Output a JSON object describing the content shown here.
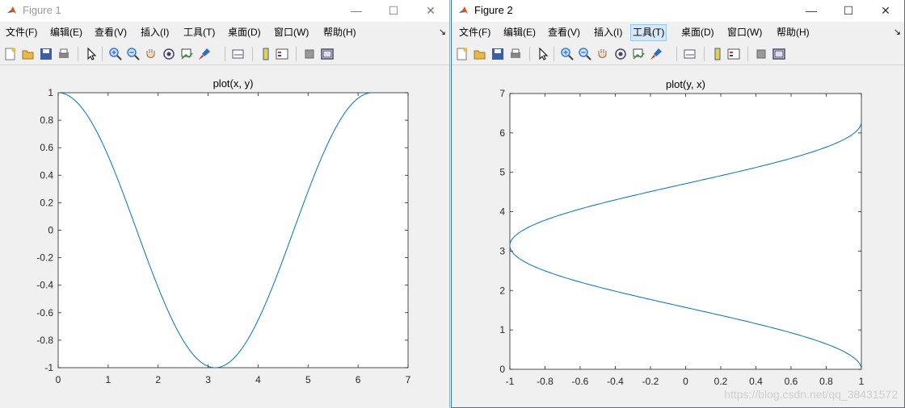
{
  "windows": [
    {
      "title": "Figure 1",
      "active": false,
      "menu": [
        "文件(F)",
        "编辑(E)",
        "查看(V)",
        "插入(I)",
        "工具(T)",
        "桌面(D)",
        "窗口(W)",
        "帮助(H)"
      ],
      "highlighted_menu": null
    },
    {
      "title": "Figure 2",
      "active": true,
      "menu": [
        "文件(F)",
        "编辑(E)",
        "查看(V)",
        "插入(I)",
        "工具(T)",
        "桌面(D)",
        "窗口(W)",
        "帮助(H)"
      ],
      "highlighted_menu": "工具(T)"
    }
  ],
  "window_controls": {
    "minimize": "—",
    "maximize": "☐",
    "close": "✕"
  },
  "menu_overflow": "↘",
  "toolbar_icons": [
    "new-figure-icon",
    "open-icon",
    "save-icon",
    "print-icon",
    "pointer-icon",
    "zoom-in-icon",
    "zoom-out-icon",
    "pan-icon",
    "rotate-3d-icon",
    "data-cursor-icon",
    "brush-icon",
    "link-plot-icon",
    "colorbar-icon",
    "legend-icon",
    "hide-plot-tools-icon",
    "show-plot-tools-icon"
  ],
  "chart_data": [
    {
      "type": "line",
      "title": "plot(x, y)",
      "xlabel": "",
      "ylabel": "",
      "xlim": [
        0,
        7
      ],
      "ylim": [
        -1,
        1
      ],
      "xticks": [
        "0",
        "1",
        "2",
        "3",
        "4",
        "5",
        "6",
        "7"
      ],
      "yticks": [
        "-1",
        "-0.8",
        "-0.6",
        "-0.4",
        "-0.2",
        "0",
        "0.2",
        "0.4",
        "0.6",
        "0.8",
        "1"
      ],
      "series": [
        {
          "function": "y = cos(x)",
          "x_range": [
            0,
            6.2832
          ],
          "color": "#0072bd"
        }
      ]
    },
    {
      "type": "line",
      "title": "plot(y, x)",
      "xlabel": "",
      "ylabel": "",
      "xlim": [
        -1,
        1
      ],
      "ylim": [
        0,
        7
      ],
      "xticks": [
        "-1",
        "-0.8",
        "-0.6",
        "-0.4",
        "-0.2",
        "0",
        "0.2",
        "0.4",
        "0.6",
        "0.8",
        "1"
      ],
      "yticks": [
        "0",
        "1",
        "2",
        "3",
        "4",
        "5",
        "6",
        "7"
      ],
      "series": [
        {
          "function": "x = cos(t), y = t",
          "t_range": [
            0,
            6.2832
          ],
          "color": "#0072bd"
        }
      ]
    }
  ],
  "watermark": "https://blog.csdn.net/qq_38431572"
}
